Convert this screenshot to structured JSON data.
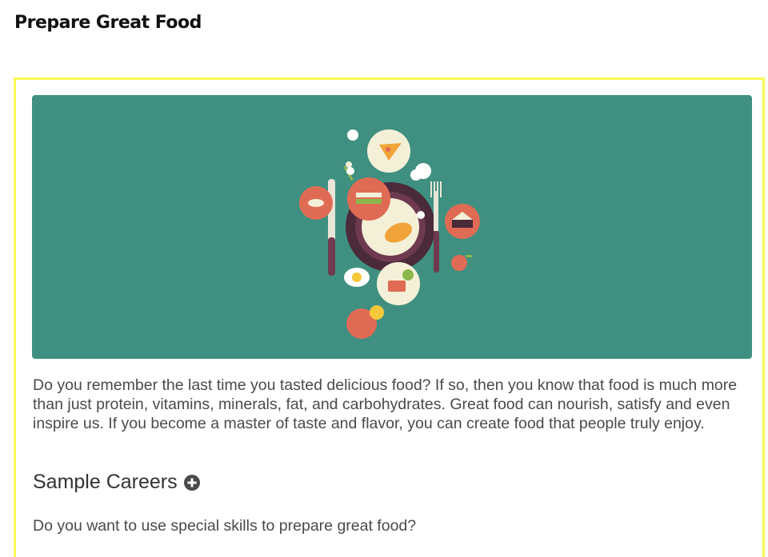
{
  "page": {
    "title": "Prepare Great Food"
  },
  "article": {
    "intro": "Do you remember the last time you tasted delicious food? If so, then you know that food is much more than just protein, vitamins, minerals, fat, and carbohydrates. Great food can nourish, satisfy and even inspire us. If you become a master of taste and flavor, you can create food that people truly enjoy.",
    "section_heading": "Sample Careers",
    "question": "Do you want to use special skills to prepare great food?"
  },
  "colors": {
    "frame_border": "#f7f955",
    "hero_background": "#3f9080",
    "accent_coral": "#e06b55",
    "plate_dark": "#4b2a3a"
  },
  "icons": {
    "expand": "plus-circle-icon",
    "illustration": "food-plate-illustration"
  }
}
